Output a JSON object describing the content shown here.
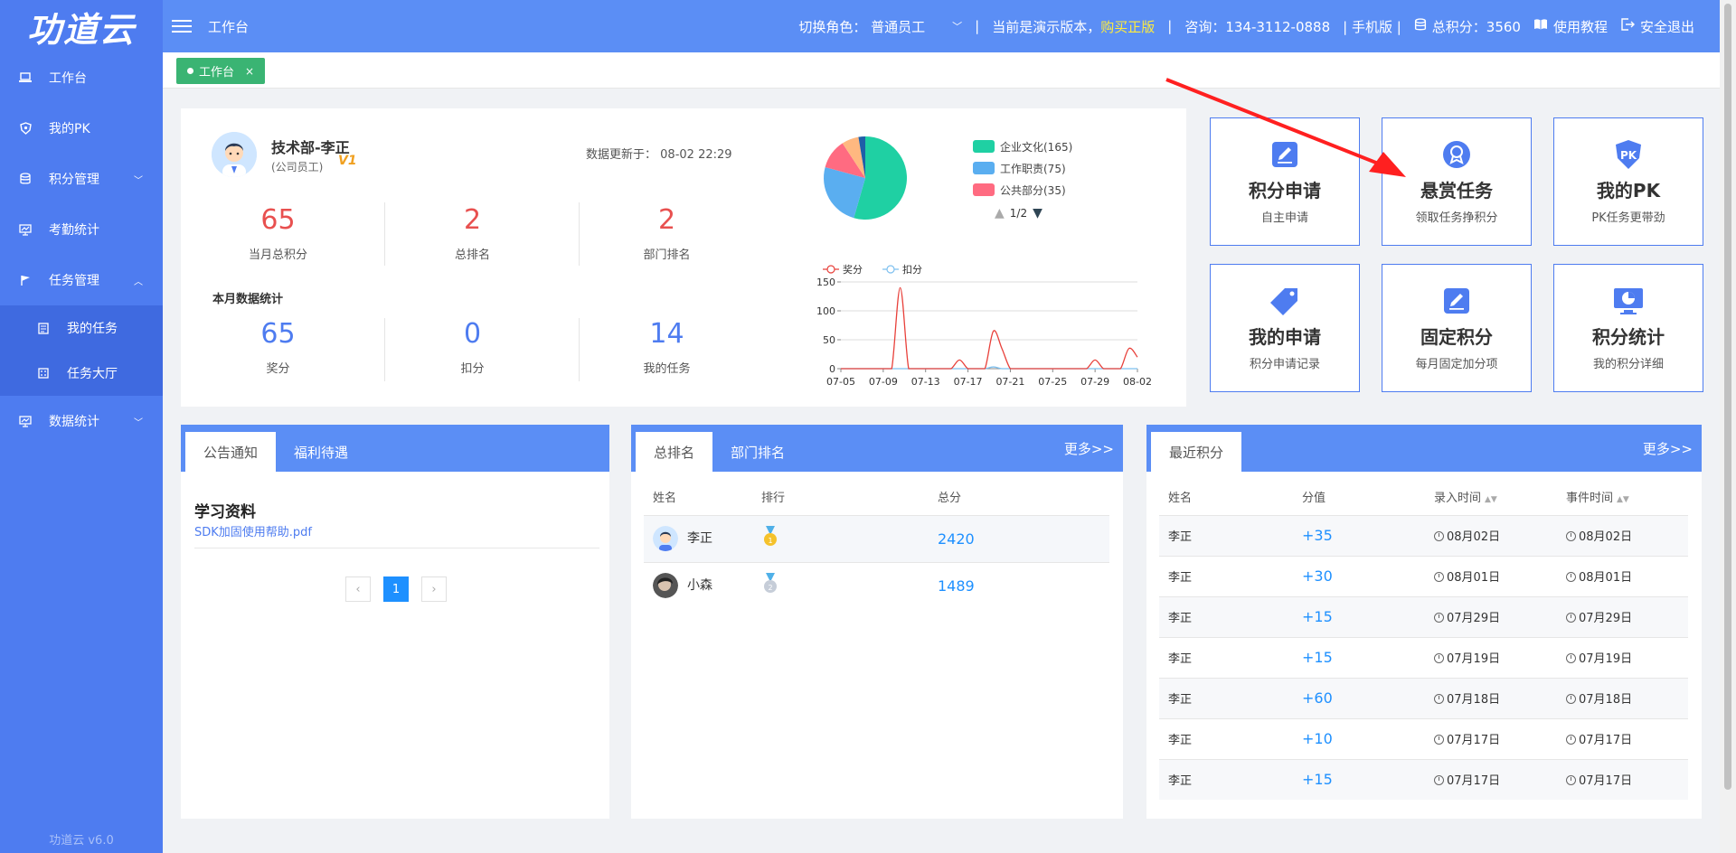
{
  "sidebar": {
    "logo": "功道云",
    "items": [
      {
        "label": "工作台"
      },
      {
        "label": "我的PK"
      },
      {
        "label": "积分管理"
      },
      {
        "label": "考勤统计"
      },
      {
        "label": "任务管理"
      }
    ],
    "sub_items": [
      {
        "label": "我的任务"
      },
      {
        "label": "任务大厅"
      }
    ],
    "last_item": {
      "label": "数据统计"
    },
    "footer": "功道云 v6.0"
  },
  "topbar": {
    "title": "工作台",
    "role_label": "切换角色：",
    "role_value": "普通员工",
    "sep1": "|",
    "demo_text": "当前是演示版本，",
    "buy_link": "购买正版",
    "sep2": "|",
    "consult": "咨询：134-3112-0888",
    "mobile": "| 手机版 |",
    "total_points": "总积分：3560",
    "tutorial": "使用教程",
    "logout": "安全退出"
  },
  "tabs": {
    "active_label": "工作台",
    "close": "×"
  },
  "profile": {
    "name": "技术部-李正",
    "role": "(公司员工)",
    "level_badge": "V1",
    "update_label": "数据更新于：",
    "update_time": "08-02 22:29",
    "month_label": "本月数据统计",
    "stats_top": [
      {
        "value": "65",
        "label": "当月总积分"
      },
      {
        "value": "2",
        "label": "总排名"
      },
      {
        "value": "2",
        "label": "部门排名"
      }
    ],
    "stats_bottom": [
      {
        "value": "65",
        "label": "奖分"
      },
      {
        "value": "0",
        "label": "扣分"
      },
      {
        "value": "14",
        "label": "我的任务"
      }
    ]
  },
  "pie_legend": {
    "items": [
      {
        "label": "企业文化(165)",
        "color": "#1fd0a3"
      },
      {
        "label": "工作职责(75)",
        "color": "#5aaef0"
      },
      {
        "label": "公共部分(35)",
        "color": "#ff6b81"
      }
    ],
    "page": "1/2"
  },
  "chart_data": [
    {
      "type": "pie",
      "slices": [
        {
          "label": "企业文化",
          "value": 165,
          "color": "#1fd0a3"
        },
        {
          "label": "工作职责",
          "value": 75,
          "color": "#5aaef0"
        },
        {
          "label": "公共部分",
          "value": 35,
          "color": "#ff6b81"
        },
        {
          "label": "",
          "value": 20,
          "color": "#ffb880"
        },
        {
          "label": "",
          "value": 8,
          "color": "#1f5fa8"
        }
      ]
    },
    {
      "type": "line",
      "x_ticks": [
        "07-05",
        "07-09",
        "07-13",
        "07-17",
        "07-21",
        "07-25",
        "07-29",
        "08-02"
      ],
      "ylim": [
        0,
        150
      ],
      "y_ticks": [
        0,
        50,
        100,
        150
      ],
      "grid": true,
      "legend_position": "top-left",
      "series": [
        {
          "name": "奖分",
          "color": "#e8403a",
          "values": [
            0,
            0,
            0,
            0,
            0,
            0,
            0,
            140,
            0,
            0,
            0,
            0,
            0,
            0,
            15,
            0,
            0,
            0,
            65,
            35,
            0,
            0,
            0,
            0,
            0,
            0,
            0,
            0,
            0,
            0,
            15,
            0,
            0,
            0,
            35,
            20
          ]
        },
        {
          "name": "扣分",
          "color": "#7ec0ef",
          "values": [
            0,
            0,
            0,
            0,
            0,
            0,
            0,
            0,
            0,
            0,
            0,
            0,
            0,
            0,
            0,
            0,
            0,
            0,
            3,
            0,
            0,
            0,
            0,
            0,
            0,
            0,
            0,
            0,
            0,
            0,
            0,
            0,
            0,
            0,
            0,
            0
          ]
        }
      ]
    }
  ],
  "quick": [
    {
      "title": "积分申请",
      "sub": "自主申请",
      "icon": "edit-icon"
    },
    {
      "title": "悬赏任务",
      "sub": "领取任务挣积分",
      "icon": "award-icon"
    },
    {
      "title": "我的PK",
      "sub": "PK任务更带劲",
      "icon": "pk-shield-icon"
    },
    {
      "title": "我的申请",
      "sub": "积分申请记录",
      "icon": "tag-icon"
    },
    {
      "title": "固定积分",
      "sub": "每月固定加分项",
      "icon": "edit-icon"
    },
    {
      "title": "积分统计",
      "sub": "我的积分详细",
      "icon": "monitor-chart-icon"
    }
  ],
  "notice": {
    "tabs": [
      "公告通知",
      "福利待遇"
    ],
    "title": "学习资料",
    "link": "SDK加固使用帮助.pdf",
    "pager": {
      "prev": "‹",
      "current": "1",
      "next": "›"
    }
  },
  "ranking": {
    "tabs": [
      "总排名",
      "部门排名"
    ],
    "more": "更多>>",
    "headers": [
      "姓名",
      "排行",
      "总分"
    ],
    "rows": [
      {
        "name": "李正",
        "score": "2420"
      },
      {
        "name": "小森",
        "score": "1489"
      }
    ]
  },
  "recent": {
    "tab": "最近积分",
    "more": "更多>>",
    "headers": [
      "姓名",
      "分值",
      "录入时间",
      "事件时间"
    ],
    "rows": [
      {
        "name": "李正",
        "value": "+35",
        "entry": "08月02日",
        "event": "08月02日"
      },
      {
        "name": "李正",
        "value": "+30",
        "entry": "08月01日",
        "event": "08月01日"
      },
      {
        "name": "李正",
        "value": "+15",
        "entry": "07月29日",
        "event": "07月29日"
      },
      {
        "name": "李正",
        "value": "+15",
        "entry": "07月19日",
        "event": "07月19日"
      },
      {
        "name": "李正",
        "value": "+60",
        "entry": "07月18日",
        "event": "07月18日"
      },
      {
        "name": "李正",
        "value": "+10",
        "entry": "07月17日",
        "event": "07月17日"
      },
      {
        "name": "李正",
        "value": "+15",
        "entry": "07月17日",
        "event": "07月17日"
      }
    ]
  },
  "colors": {
    "sidebar": "#4e7cf0",
    "topbar": "#5b8ef5",
    "accent": "#1e90ff",
    "red_stat": "#e8504f",
    "blue_stat": "#4e7cf0"
  }
}
